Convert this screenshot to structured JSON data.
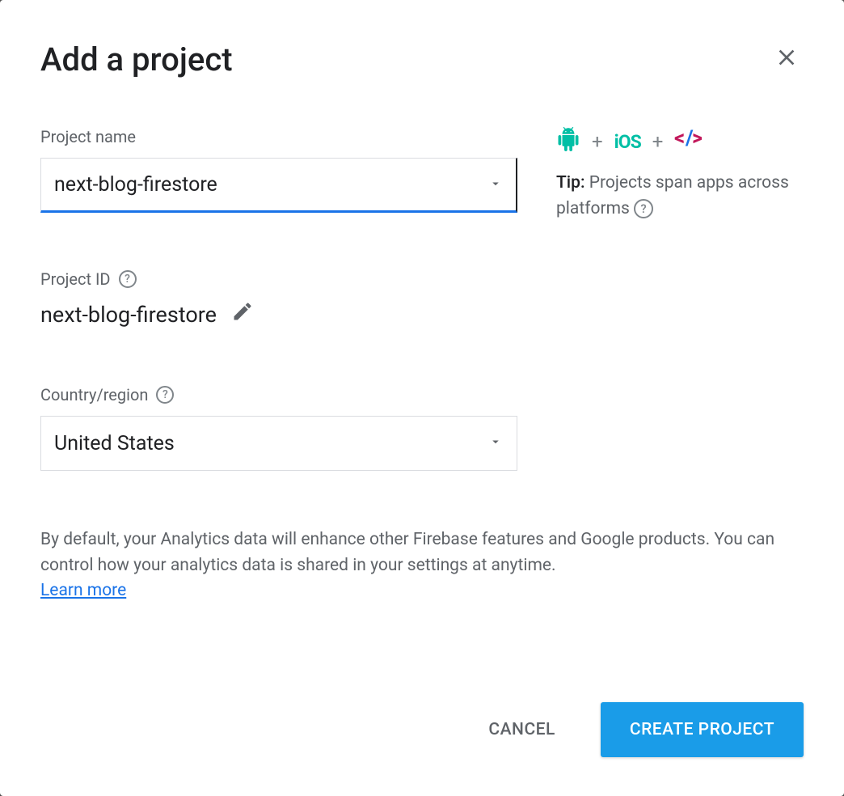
{
  "dialog": {
    "title": "Add a project",
    "close_label": "Close"
  },
  "project_name": {
    "label": "Project name",
    "value": "next-blog-firestore"
  },
  "tip": {
    "label": "Tip:",
    "text": "Projects span apps across platforms"
  },
  "project_id": {
    "label": "Project ID",
    "value": "next-blog-firestore"
  },
  "country": {
    "label": "Country/region",
    "value": "United States"
  },
  "disclaimer": {
    "text": "By default, your Analytics data will enhance other Firebase features and Google products. You can control how your analytics data is shared in your settings at anytime.",
    "learn_more": "Learn more"
  },
  "buttons": {
    "cancel": "CANCEL",
    "create": "CREATE PROJECT"
  },
  "icons": {
    "ios": "iOS"
  }
}
